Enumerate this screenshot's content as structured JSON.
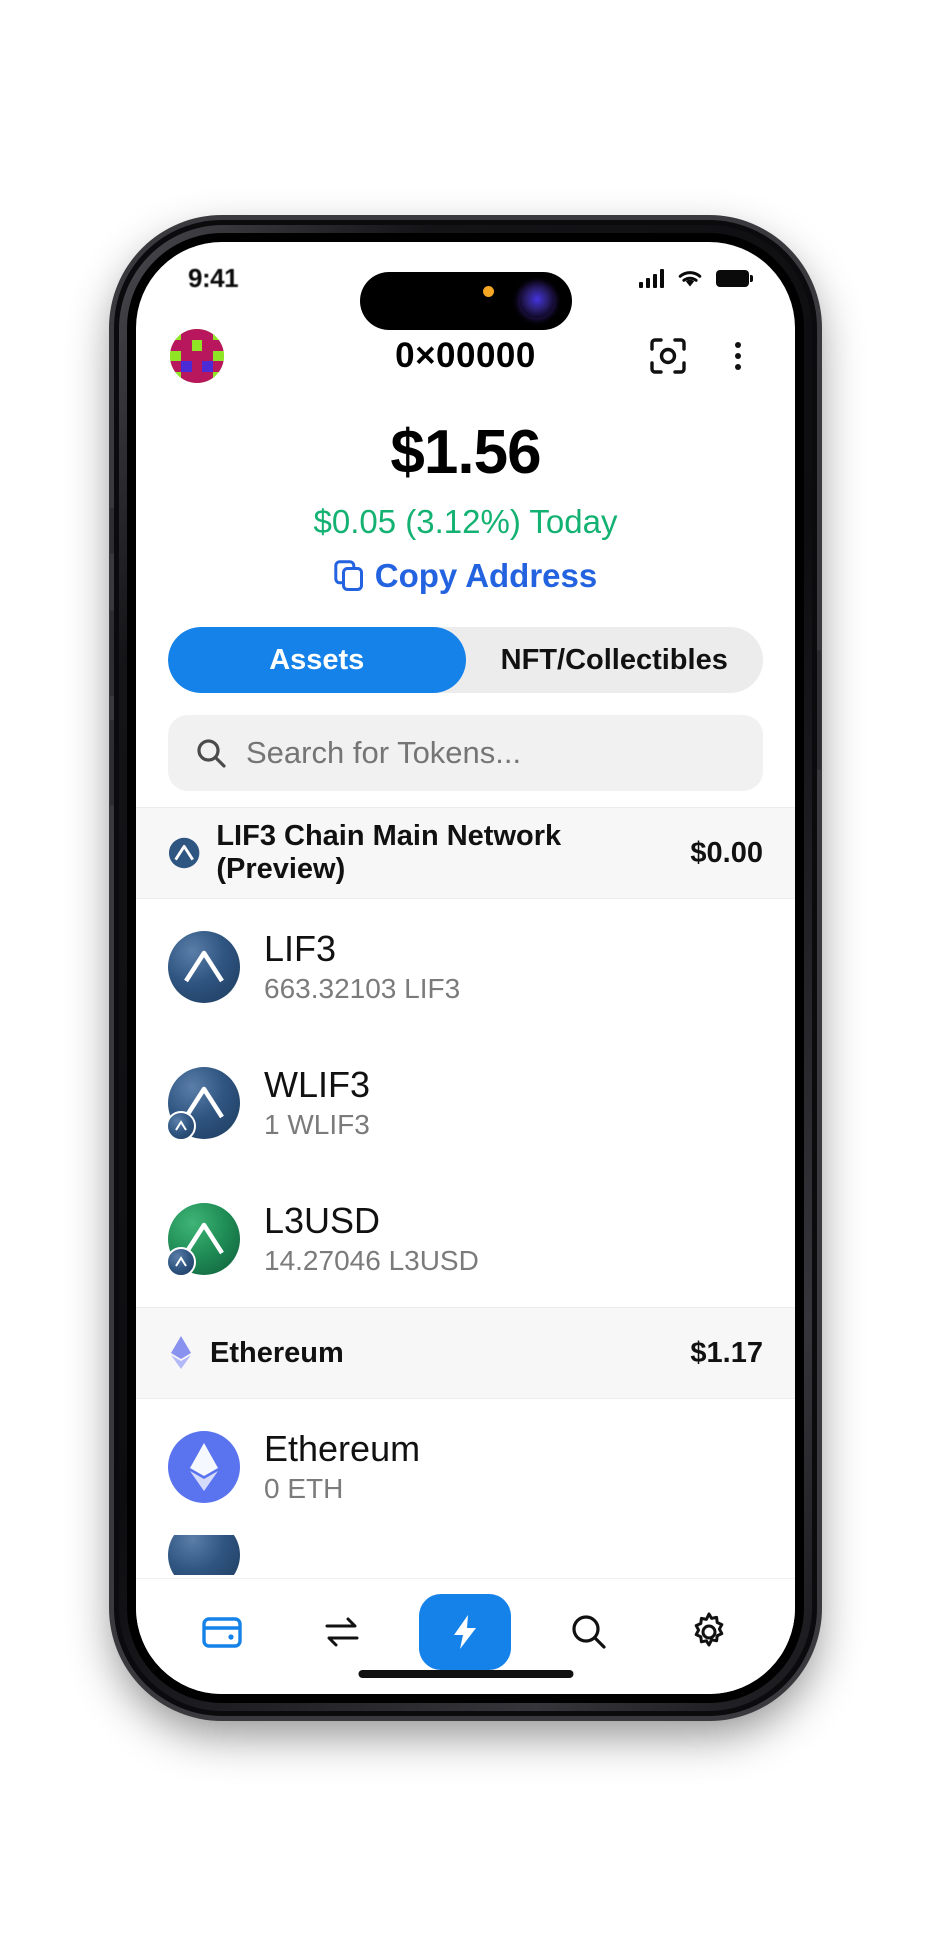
{
  "status_bar": {
    "time": "9:41",
    "signal_icon": "cellular-signal-icon",
    "wifi_icon": "wifi-icon",
    "battery_icon": "battery-icon"
  },
  "header": {
    "avatar_label": "wallet-identicon",
    "address": "0×00000",
    "scan_icon": "scan-qr-icon",
    "menu_icon": "more-options-icon",
    "avatar_colors": [
      "#8fe425",
      "#b8175e",
      "#4a2bd6",
      "#7e1038"
    ]
  },
  "balance": {
    "total": "$1.56",
    "change": "$0.05 (3.12%) Today",
    "change_color": "#14b272",
    "copy_label": "Copy Address",
    "copy_icon": "copy-icon",
    "copy_color": "#2463e0"
  },
  "tabs": {
    "active_index": 0,
    "accent": "#1482e8",
    "items": [
      {
        "label": "Assets"
      },
      {
        "label": "NFT/Collectibles"
      }
    ]
  },
  "search": {
    "placeholder": "Search for Tokens...",
    "icon": "search-icon",
    "value": ""
  },
  "networks": [
    {
      "name": "LIF3 Chain Main Network (Preview)",
      "value": "$0.00",
      "icon": "lif3-network-icon",
      "tokens": [
        {
          "name": "LIF3",
          "amount": "663.32103 LIF3",
          "logo": "lif3-token-icon",
          "logo_class": "lif3",
          "has_badge": false
        },
        {
          "name": "WLIF3",
          "amount": "1 WLIF3",
          "logo": "wlif3-token-icon",
          "logo_class": "lif3",
          "has_badge": true
        },
        {
          "name": "L3USD",
          "amount": "14.27046 L3USD",
          "logo": "l3usd-token-icon",
          "logo_class": "l3usd",
          "has_badge": true
        }
      ]
    },
    {
      "name": "Ethereum",
      "value": "$1.17",
      "icon": "ethereum-network-icon",
      "tokens": [
        {
          "name": "Ethereum",
          "amount": "0 ETH",
          "logo": "ethereum-token-icon",
          "logo_class": "eth",
          "has_badge": false
        }
      ]
    }
  ],
  "bottom_nav": {
    "active_index": 2,
    "accent": "#1482e8",
    "items": [
      {
        "icon": "wallet-icon"
      },
      {
        "icon": "swap-icon"
      },
      {
        "icon": "lightning-icon"
      },
      {
        "icon": "search-icon"
      },
      {
        "icon": "settings-gear-icon"
      }
    ]
  }
}
